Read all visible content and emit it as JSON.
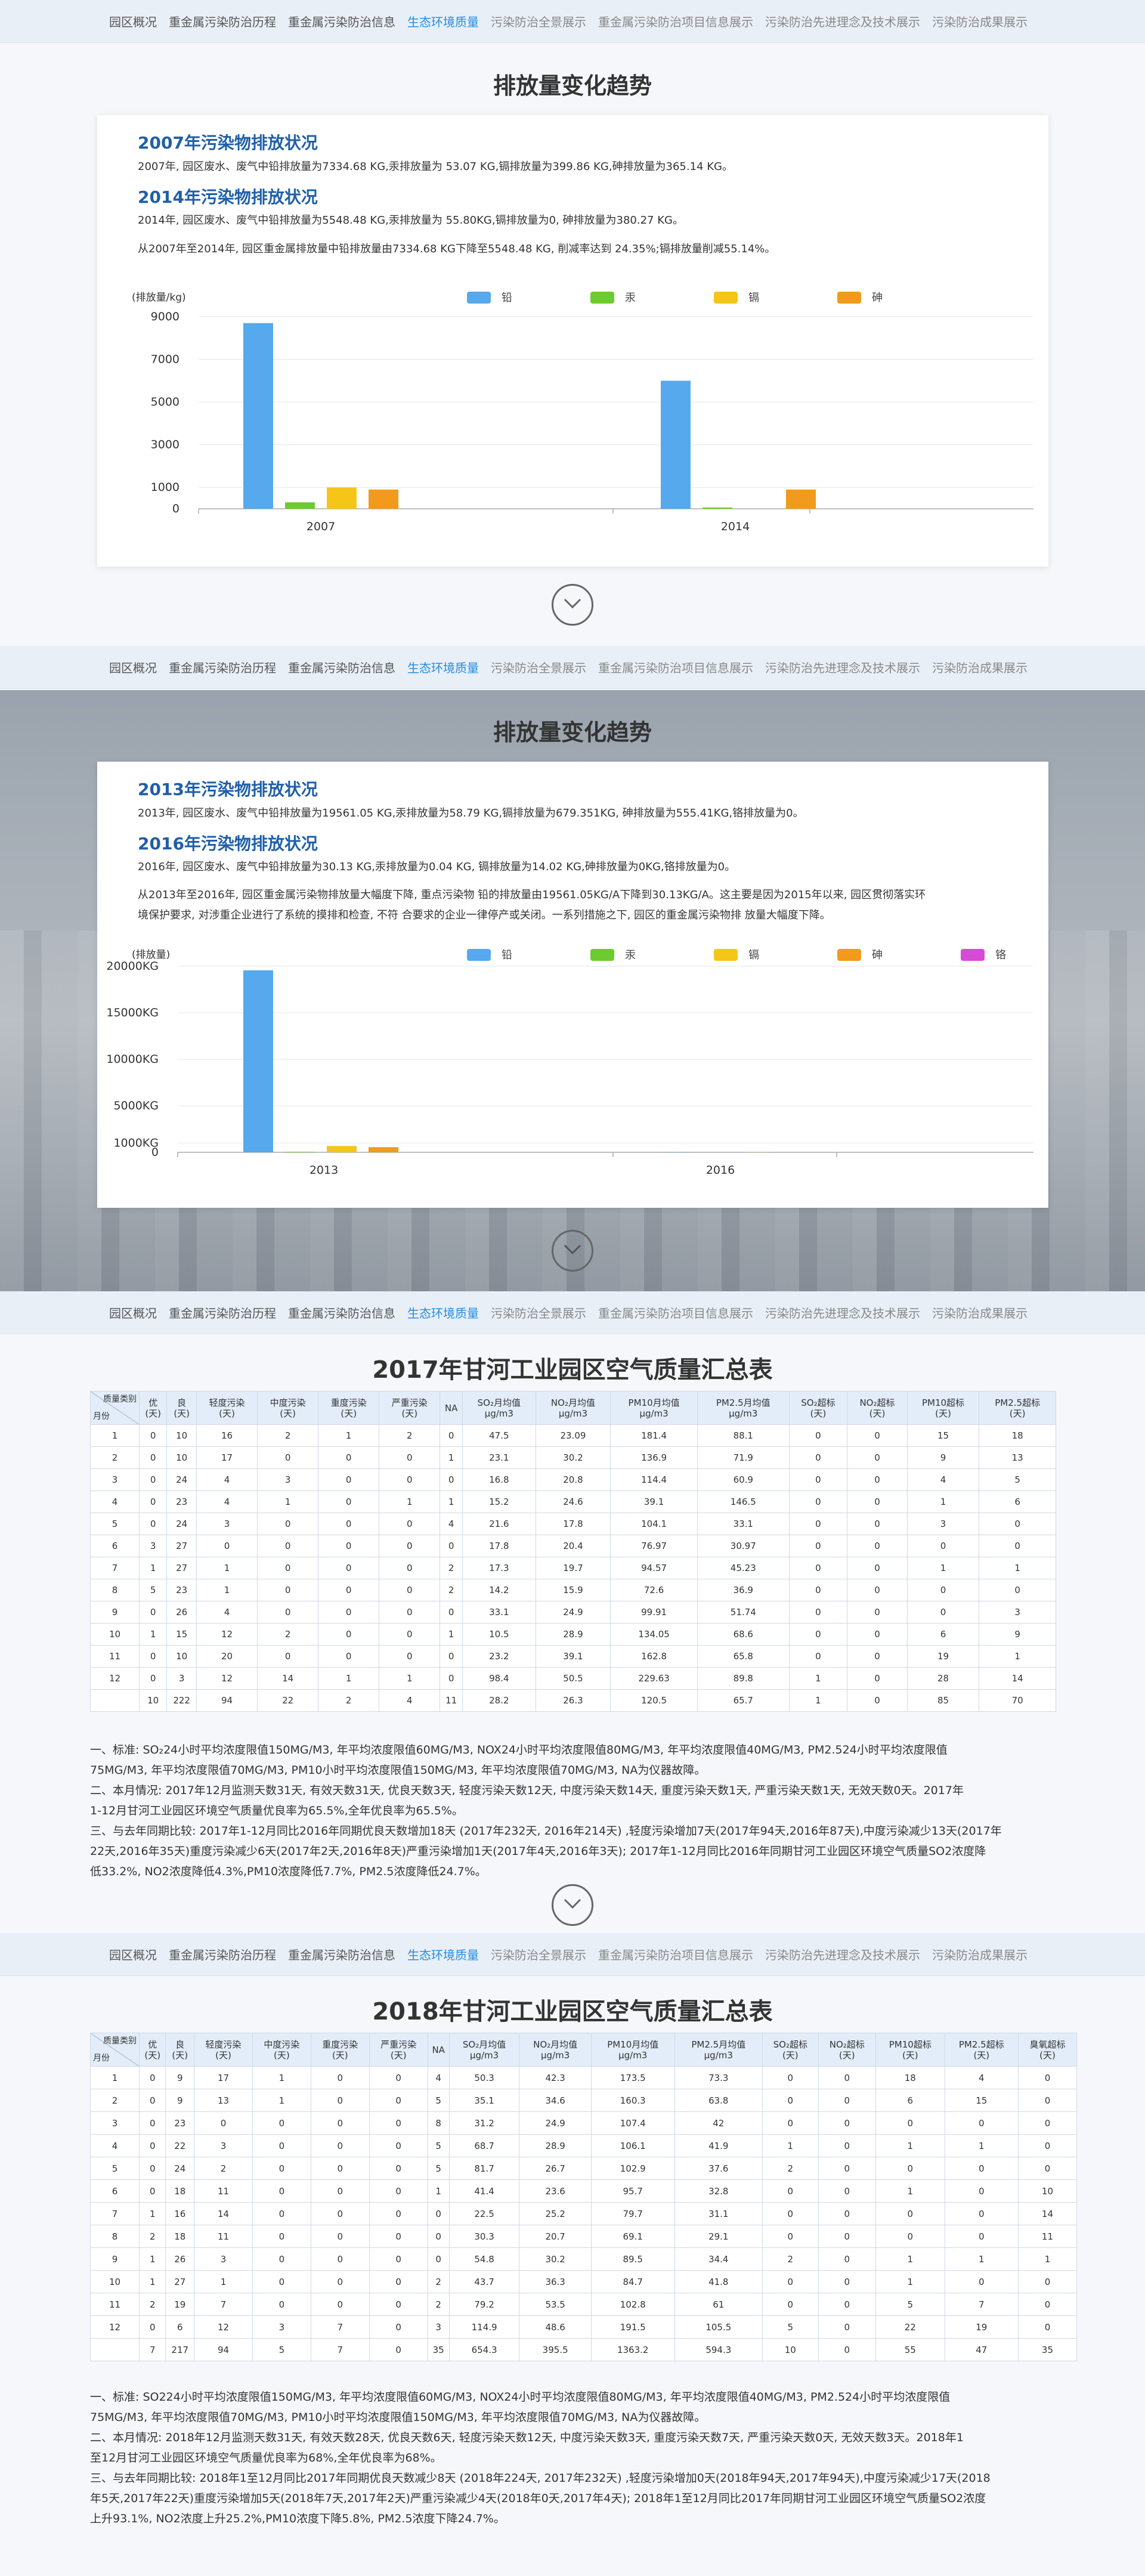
{
  "nav": {
    "items": [
      "园区概况",
      "重金属污染防治历程",
      "重金属污染防治信息",
      "生态环境质量",
      "污染防治全景展示",
      "重金属污染防治项目信息展示",
      "污染防治先进理念及技术展示",
      "污染防治成果展示"
    ],
    "active_index": 3
  },
  "section1": {
    "title": "排放量变化趋势",
    "h1": "2007年污染物排放状况",
    "p1": "2007年, 园区废水、废气中铅排放量为7334.68 KG,汞排放量为 53.07 KG,镉排放量为399.86 KG,砷排放量为365.14 KG。",
    "h2": "2014年污染物排放状况",
    "p2": "2014年, 园区废水、废气中铅排放量为5548.48 KG,汞排放量为 55.80KG,镉排放量为0, 砷排放量为380.27 KG。",
    "p3": "从2007年至2014年, 园区重金属排放量中铅排放量由7334.68 KG下降至5548.48 KG, 削减率达到 24.35%;镉排放量削减55.14%。"
  },
  "section2": {
    "title": "排放量变化趋势",
    "h1": "2013年污染物排放状况",
    "p1": "2013年, 园区废水、废气中铅排放量为19561.05 KG,汞排放量为58.79 KG,镉排放量为679.351KG, 砷排放量为555.41KG,铬排放量为0。",
    "h2": "2016年污染物排放状况",
    "p2": "2016年, 园区废水、废气中铅排放量为30.13 KG,汞排放量为0.04 KG,   镉排放量为14.02 KG,砷排放量为0KG,铬排放量为0。",
    "p3a": "从2013年至2016年, 园区重金属污染物排放量大幅度下降, 重点污染物 铅的排放量由19561.05KG/A下降到30.13KG/A。这主要是因为2015年以来,  园区贯彻落实环",
    "p3b": "境保护要求, 对涉重企业进行了系统的摸排和检查, 不符 合要求的企业一律停产或关闭。一系列措施之下, 园区的重金属污染物排 放量大幅度下降。"
  },
  "chart_data": [
    {
      "type": "bar",
      "ylabel": "(排放量/kg)",
      "categories": [
        "2007",
        "2014"
      ],
      "series": [
        {
          "name": "铅",
          "color": "#56a9ec",
          "values": [
            8700,
            6000
          ]
        },
        {
          "name": "汞",
          "color": "#6ccb2e",
          "values": [
            300,
            60
          ]
        },
        {
          "name": "镉",
          "color": "#f5c518",
          "values": [
            1000,
            0
          ]
        },
        {
          "name": "砷",
          "color": "#f29a1b",
          "values": [
            900,
            900
          ]
        }
      ],
      "yticks": [
        "0",
        "1000",
        "3000",
        "5000",
        "7000",
        "9000"
      ],
      "ylim": [
        0,
        9000
      ],
      "legend": "top"
    },
    {
      "type": "bar",
      "ylabel": "(排放量)",
      "categories": [
        "2013",
        "2016"
      ],
      "series": [
        {
          "name": "铅",
          "color": "#56a9ec",
          "values": [
            19561.05,
            30.13
          ]
        },
        {
          "name": "汞",
          "color": "#6ccb2e",
          "values": [
            58.79,
            0.04
          ]
        },
        {
          "name": "镉",
          "color": "#f5c518",
          "values": [
            679.351,
            14.02
          ]
        },
        {
          "name": "砷",
          "color": "#f29a1b",
          "values": [
            555.41,
            0
          ]
        },
        {
          "name": "铬",
          "color": "#d64ad6",
          "values": [
            0,
            0
          ]
        }
      ],
      "yticks": [
        "0",
        "1000KG",
        "5000KG",
        "10000KG",
        "15000KG",
        "20000KG"
      ],
      "ylim": [
        0,
        20000
      ],
      "legend": "top"
    }
  ],
  "table2017": {
    "title": "2017年甘河工业园区空气质量汇总表",
    "corner_top": "质量类别",
    "corner_bottom": "月份",
    "headers": [
      "优\n(天)",
      "良\n(天)",
      "轻度污染\n(天)",
      "中度污染\n(天)",
      "重度污染\n(天)",
      "严重污染\n(天)",
      "NA",
      "SO₂月均值\nμg/m3",
      "NO₂月均值\nμg/m3",
      "PM10月均值\nμg/m3",
      "PM2.5月均值\nμg/m3",
      "SO₂超标\n(天)",
      "NO₂超标\n(天)",
      "PM10超标\n(天)",
      "PM2.5超标\n(天)"
    ],
    "rows": [
      [
        "1",
        "0",
        "10",
        "16",
        "2",
        "1",
        "2",
        "0",
        "47.5",
        "23.09",
        "181.4",
        "88.1",
        "0",
        "0",
        "15",
        "18"
      ],
      [
        "2",
        "0",
        "10",
        "17",
        "0",
        "0",
        "0",
        "1",
        "23.1",
        "30.2",
        "136.9",
        "71.9",
        "0",
        "0",
        "9",
        "13"
      ],
      [
        "3",
        "0",
        "24",
        "4",
        "3",
        "0",
        "0",
        "0",
        "16.8",
        "20.8",
        "114.4",
        "60.9",
        "0",
        "0",
        "4",
        "5"
      ],
      [
        "4",
        "0",
        "23",
        "4",
        "1",
        "0",
        "1",
        "1",
        "15.2",
        "24.6",
        "39.1",
        "146.5",
        "0",
        "0",
        "1",
        "6"
      ],
      [
        "5",
        "0",
        "24",
        "3",
        "0",
        "0",
        "0",
        "4",
        "21.6",
        "17.8",
        "104.1",
        "33.1",
        "0",
        "0",
        "3",
        "0"
      ],
      [
        "6",
        "3",
        "27",
        "0",
        "0",
        "0",
        "0",
        "0",
        "17.8",
        "20.4",
        "76.97",
        "30.97",
        "0",
        "0",
        "0",
        "0"
      ],
      [
        "7",
        "1",
        "27",
        "1",
        "0",
        "0",
        "0",
        "2",
        "17.3",
        "19.7",
        "94.57",
        "45.23",
        "0",
        "0",
        "1",
        "1"
      ],
      [
        "8",
        "5",
        "23",
        "1",
        "0",
        "0",
        "0",
        "2",
        "14.2",
        "15.9",
        "72.6",
        "36.9",
        "0",
        "0",
        "0",
        "0"
      ],
      [
        "9",
        "0",
        "26",
        "4",
        "0",
        "0",
        "0",
        "0",
        "33.1",
        "24.9",
        "99.91",
        "51.74",
        "0",
        "0",
        "0",
        "3"
      ],
      [
        "10",
        "1",
        "15",
        "12",
        "2",
        "0",
        "0",
        "1",
        "10.5",
        "28.9",
        "134.05",
        "68.6",
        "0",
        "0",
        "6",
        "9"
      ],
      [
        "11",
        "0",
        "10",
        "20",
        "0",
        "0",
        "0",
        "0",
        "23.2",
        "39.1",
        "162.8",
        "65.8",
        "0",
        "0",
        "19",
        "1"
      ],
      [
        "12",
        "0",
        "3",
        "12",
        "14",
        "1",
        "1",
        "0",
        "98.4",
        "50.5",
        "229.63",
        "89.8",
        "1",
        "0",
        "28",
        "14"
      ],
      [
        "",
        "10",
        "222",
        "94",
        "22",
        "2",
        "4",
        "11",
        "28.2",
        "26.3",
        "120.5",
        "65.7",
        "1",
        "0",
        "85",
        "70"
      ]
    ],
    "notes": [
      "一、标准: SO₂24小时平均浓度限值150MG/M3, 年平均浓度限值60MG/M3, NOX24小时平均浓度限值80MG/M3, 年平均浓度限值40MG/M3, PM2.524小时平均浓度限值",
      "75MG/M3, 年平均浓度限值70MG/M3, PM10小时平均浓度限值150MG/M3, 年平均浓度限值70MG/M3, NA为仪器故障。",
      "二、本月情况: 2017年12月监测天数31天, 有效天数31天, 优良天数3天, 轻度污染天数12天, 中度污染天数14天, 重度污染天数1天, 严重污染天数1天, 无效天数0天。2017年",
      "1-12月甘河工业园区环境空气质量优良率为65.5%,全年优良率为65.5%。",
      "三、与去年同期比较: 2017年1-12月同比2016年同期优良天数增加18天 (2017年232天, 2016年214天) ,轻度污染增加7天(2017年94天,2016年87天),中度污染减少13天(2017年",
      "22天,2016年35天)重度污染减少6天(2017年2天,2016年8天)严重污染增加1天(2017年4天,2016年3天); 2017年1-12月同比2016年同期甘河工业园区环境空气质量SO2浓度降",
      "低33.2%, NO2浓度降低4.3%,PM10浓度降低7.7%, PM2.5浓度降低24.7%。"
    ]
  },
  "table2018": {
    "title": "2018年甘河工业园区空气质量汇总表",
    "corner_top": "质量类别",
    "corner_bottom": "月份",
    "headers": [
      "优\n(天)",
      "良\n(天)",
      "轻度污染\n(天)",
      "中度污染\n(天)",
      "重度污染\n(天)",
      "严重污染\n(天)",
      "NA",
      "SO₂月均值\nμg/m3",
      "NO₂月均值\nμg/m3",
      "PM10月均值\nμg/m3",
      "PM2.5月均值\nμg/m3",
      "SO₂超标\n(天)",
      "NO₂超标\n(天)",
      "PM10超标\n(天)",
      "PM2.5超标\n(天)",
      "臭氧超标\n(天)"
    ],
    "rows": [
      [
        "1",
        "0",
        "9",
        "17",
        "1",
        "0",
        "0",
        "4",
        "50.3",
        "42.3",
        "173.5",
        "73.3",
        "0",
        "0",
        "18",
        "4",
        "0"
      ],
      [
        "2",
        "0",
        "9",
        "13",
        "1",
        "0",
        "0",
        "5",
        "35.1",
        "34.6",
        "160.3",
        "63.8",
        "0",
        "0",
        "6",
        "15",
        "0"
      ],
      [
        "3",
        "0",
        "23",
        "0",
        "0",
        "0",
        "0",
        "8",
        "31.2",
        "24.9",
        "107.4",
        "42",
        "0",
        "0",
        "0",
        "0",
        "0"
      ],
      [
        "4",
        "0",
        "22",
        "3",
        "0",
        "0",
        "0",
        "5",
        "68.7",
        "28.9",
        "106.1",
        "41.9",
        "1",
        "0",
        "1",
        "1",
        "0"
      ],
      [
        "5",
        "0",
        "24",
        "2",
        "0",
        "0",
        "0",
        "5",
        "81.7",
        "26.7",
        "102.9",
        "37.6",
        "2",
        "0",
        "0",
        "0",
        "0"
      ],
      [
        "6",
        "0",
        "18",
        "11",
        "0",
        "0",
        "0",
        "1",
        "41.4",
        "23.6",
        "95.7",
        "32.8",
        "0",
        "0",
        "1",
        "0",
        "10"
      ],
      [
        "7",
        "1",
        "16",
        "14",
        "0",
        "0",
        "0",
        "0",
        "22.5",
        "25.2",
        "79.7",
        "31.1",
        "0",
        "0",
        "0",
        "0",
        "14"
      ],
      [
        "8",
        "2",
        "18",
        "11",
        "0",
        "0",
        "0",
        "0",
        "30.3",
        "20.7",
        "69.1",
        "29.1",
        "0",
        "0",
        "0",
        "0",
        "11"
      ],
      [
        "9",
        "1",
        "26",
        "3",
        "0",
        "0",
        "0",
        "0",
        "54.8",
        "30.2",
        "89.5",
        "34.4",
        "2",
        "0",
        "1",
        "1",
        "1"
      ],
      [
        "10",
        "1",
        "27",
        "1",
        "0",
        "0",
        "0",
        "2",
        "43.7",
        "36.3",
        "84.7",
        "41.8",
        "0",
        "0",
        "1",
        "0",
        "0"
      ],
      [
        "11",
        "2",
        "19",
        "7",
        "0",
        "0",
        "0",
        "2",
        "79.2",
        "53.5",
        "102.8",
        "61",
        "0",
        "0",
        "5",
        "7",
        "0"
      ],
      [
        "12",
        "0",
        "6",
        "12",
        "3",
        "7",
        "0",
        "3",
        "114.9",
        "48.6",
        "191.5",
        "105.5",
        "5",
        "0",
        "22",
        "19",
        "0"
      ],
      [
        "",
        "7",
        "217",
        "94",
        "5",
        "7",
        "0",
        "35",
        "654.3",
        "395.5",
        "1363.2",
        "594.3",
        "10",
        "0",
        "55",
        "47",
        "35"
      ]
    ],
    "notes": [
      "一、标准: SO224小时平均浓度限值150MG/M3, 年平均浓度限值60MG/M3, NOX24小时平均浓度限值80MG/M3, 年平均浓度限值40MG/M3, PM2.524小时平均浓度限值",
      "75MG/M3, 年平均浓度限值70MG/M3, PM10小时平均浓度限值150MG/M3, 年平均浓度限值70MG/M3, NA为仪器故障。",
      "二、本月情况: 2018年12月监测天数31天, 有效天数28天, 优良天数6天, 轻度污染天数12天, 中度污染天数3天, 重度污染天数7天, 严重污染天数0天, 无效天数3天。2018年1",
      "至12月甘河工业园区环境空气质量优良率为68%,全年优良率为68%。",
      "三、与去年同期比较: 2018年1至12月同比2017年同期优良天数减少8天 (2018年224天, 2017年232天) ,轻度污染增加0天(2018年94天,2017年94天),中度污染减少17天(2018",
      "年5天,2017年22天)重度污染增加5天(2018年7天,2017年2天)严重污染减少4天(2018年0天,2017年4天); 2018年1至12月同比2017年同期甘河工业园区环境空气质量SO2浓度",
      "上升93.1%, NO2浓度上升25.2%,PM10浓度下降5.8%, PM2.5浓度下降24.7%。"
    ]
  },
  "icons": {
    "scroll_down": "chevron-down-circle-icon"
  }
}
